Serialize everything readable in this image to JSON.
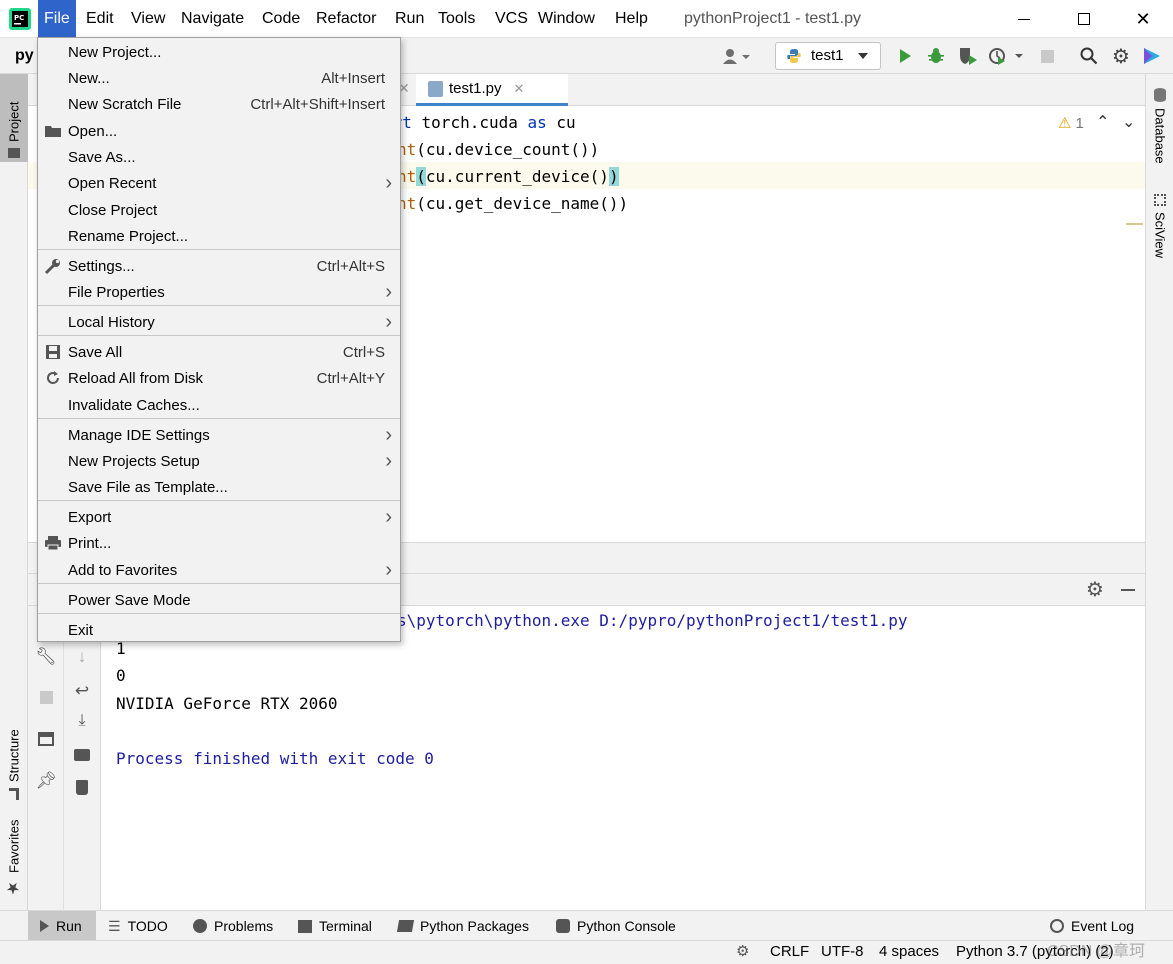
{
  "titlebar": {
    "menus": [
      "File",
      "Edit",
      "View",
      "Navigate",
      "Code",
      "Refactor",
      "Run",
      "Tools",
      "VCS",
      "Window",
      "Help"
    ],
    "title": "pythonProject1 - test1.py"
  },
  "navbar": {
    "breadcrumb": "py",
    "run_config": "test1"
  },
  "editor": {
    "tab_label": "test1.py",
    "inspection_count": "1",
    "lines": [
      {
        "pre": "",
        "kw": "ort",
        "rest": " torch.cuda ",
        "kw2": "as",
        "rest2": " cu"
      },
      {
        "print": "nt",
        "args": "(cu.device_count())"
      },
      {
        "print": "nt",
        "open": "(",
        "mid": "cu.current_device()",
        "close": ")"
      },
      {
        "print": "nt",
        "args": "(cu.get_device_name())"
      }
    ]
  },
  "run": {
    "console": {
      "command": "s\\pytorch\\python.exe D:/pypro/pythonProject1/test1.py",
      "output": [
        "1",
        "0",
        "NVIDIA GeForce RTX 2060"
      ],
      "finish": "Process finished with exit code 0"
    }
  },
  "left_tabs": {
    "project": "Project",
    "structure": "Structure",
    "favorites": "Favorites"
  },
  "right_tabs": {
    "database": "Database",
    "sciview": "SciView"
  },
  "bottom_tabs": [
    "Run",
    "TODO",
    "Problems",
    "Terminal",
    "Python Packages",
    "Python Console"
  ],
  "event_log": "Event Log",
  "status": {
    "line_sep": "CRLF",
    "encoding": "UTF-8",
    "indent": "4 spaces",
    "interpreter": "Python 3.7 (pytorch) (2)",
    "watermark": "CSDN @章珂"
  },
  "file_menu": {
    "items": [
      {
        "label": "New Project...",
        "shortcut": "",
        "arrow": false,
        "icon": ""
      },
      {
        "label": "New...",
        "shortcut": "Alt+Insert",
        "arrow": false,
        "icon": ""
      },
      {
        "label": "New Scratch File",
        "shortcut": "Ctrl+Alt+Shift+Insert",
        "arrow": false,
        "icon": ""
      },
      {
        "label": "Open...",
        "shortcut": "",
        "arrow": false,
        "icon": "folder-icon"
      },
      {
        "label": "Save As...",
        "shortcut": "",
        "arrow": false,
        "icon": ""
      },
      {
        "label": "Open Recent",
        "shortcut": "",
        "arrow": true,
        "icon": ""
      },
      {
        "label": "Close Project",
        "shortcut": "",
        "arrow": false,
        "icon": ""
      },
      {
        "label": "Rename Project...",
        "shortcut": "",
        "arrow": false,
        "icon": ""
      },
      {
        "label": "Settings...",
        "shortcut": "Ctrl+Alt+S",
        "arrow": false,
        "icon": "wrench-icon"
      },
      {
        "label": "File Properties",
        "shortcut": "",
        "arrow": true,
        "icon": ""
      },
      {
        "label": "Local History",
        "shortcut": "",
        "arrow": true,
        "icon": ""
      },
      {
        "label": "Save All",
        "shortcut": "Ctrl+S",
        "arrow": false,
        "icon": "save-icon"
      },
      {
        "label": "Reload All from Disk",
        "shortcut": "Ctrl+Alt+Y",
        "arrow": false,
        "icon": "reload-icon"
      },
      {
        "label": "Invalidate Caches...",
        "shortcut": "",
        "arrow": false,
        "icon": ""
      },
      {
        "label": "Manage IDE Settings",
        "shortcut": "",
        "arrow": true,
        "icon": ""
      },
      {
        "label": "New Projects Setup",
        "shortcut": "",
        "arrow": true,
        "icon": ""
      },
      {
        "label": "Save File as Template...",
        "shortcut": "",
        "arrow": false,
        "icon": ""
      },
      {
        "label": "Export",
        "shortcut": "",
        "arrow": true,
        "icon": ""
      },
      {
        "label": "Print...",
        "shortcut": "",
        "arrow": false,
        "icon": "print-icon"
      },
      {
        "label": "Add to Favorites",
        "shortcut": "",
        "arrow": true,
        "icon": ""
      },
      {
        "label": "Power Save Mode",
        "shortcut": "",
        "arrow": false,
        "icon": ""
      },
      {
        "label": "Exit",
        "shortcut": "",
        "arrow": false,
        "icon": ""
      }
    ]
  },
  "colors": {
    "menu_active": "#2f65ca",
    "keyword": "#0033b3",
    "console_blue": "#1d1da0",
    "run_green": "#3b9a3b",
    "tab_underline": "#4083c9"
  }
}
